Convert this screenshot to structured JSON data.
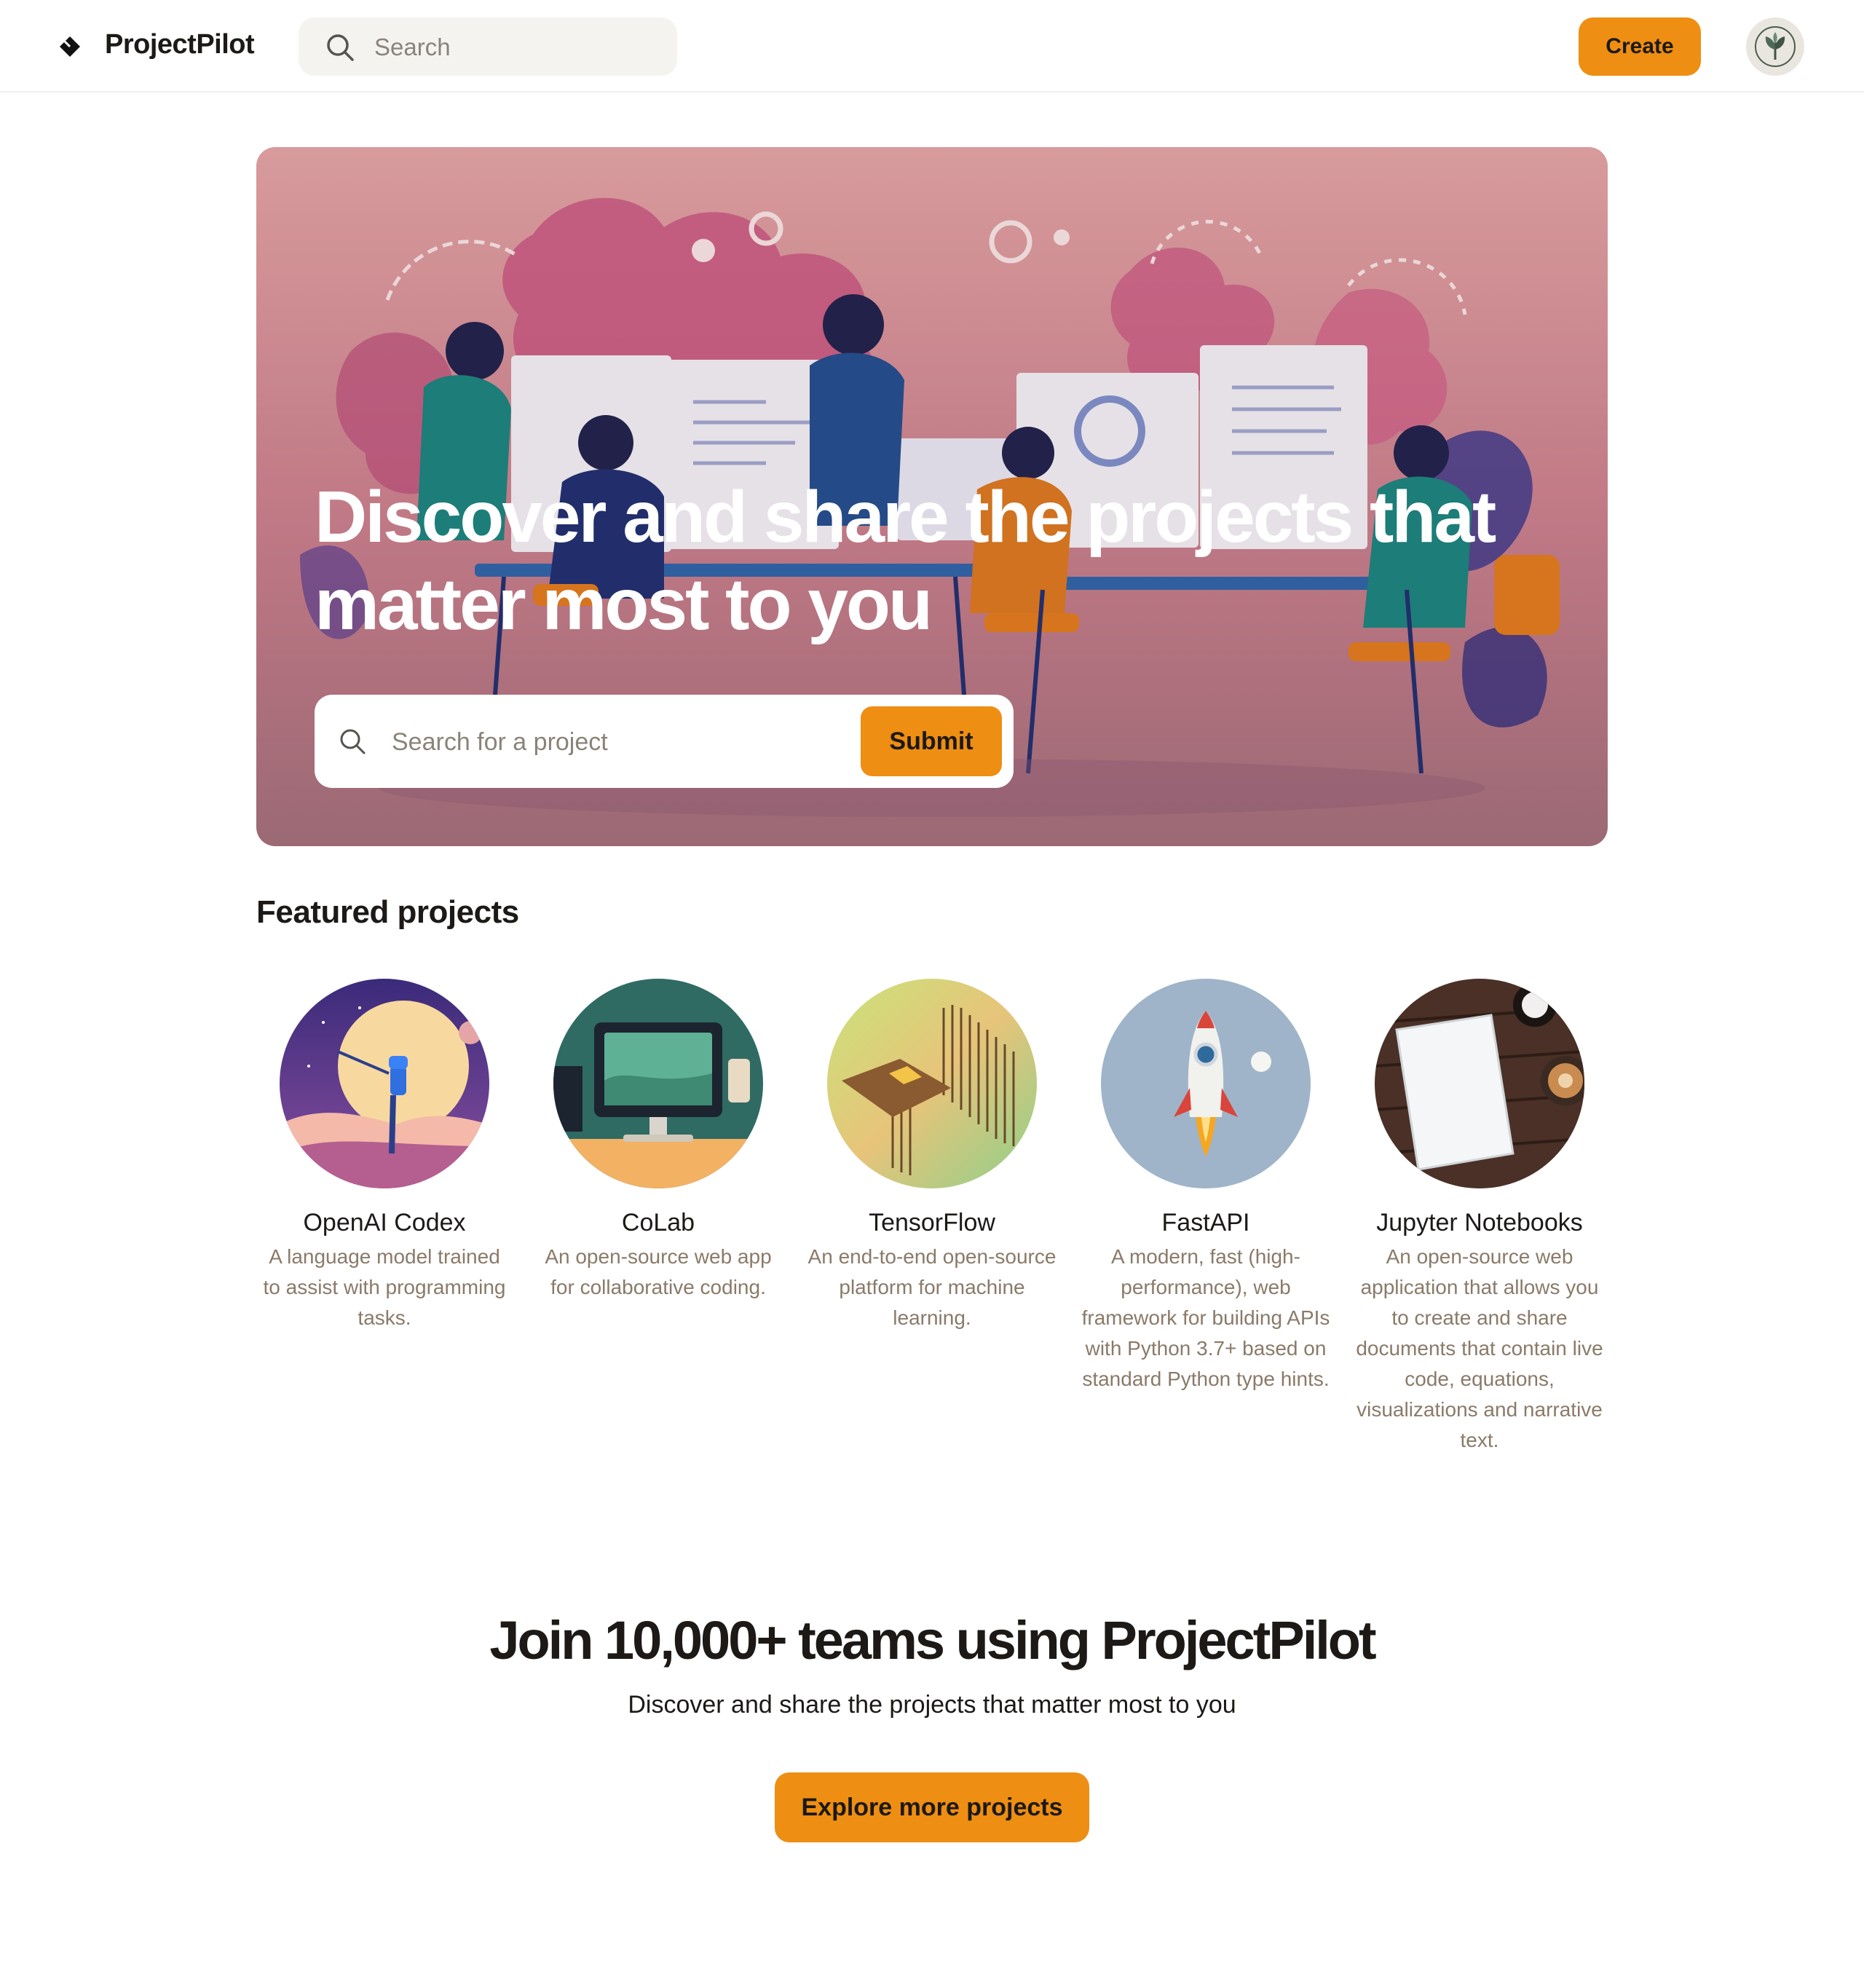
{
  "header": {
    "app_name": "ProjectPilot",
    "search_placeholder": "Search",
    "create_label": "Create"
  },
  "hero": {
    "title": "Discover and share the projects that matter most to you",
    "search_placeholder": "Search for a project",
    "submit_label": "Submit"
  },
  "featured": {
    "title": "Featured projects",
    "projects": [
      {
        "name": "OpenAI Codex",
        "description": "A language model trained to assist with programming tasks.",
        "image": "robot-moon-illustration"
      },
      {
        "name": "CoLab",
        "description": "An open-source web app for collaborative coding.",
        "image": "computer-desk-illustration"
      },
      {
        "name": "TensorFlow",
        "description": "An end-to-end open-source platform for machine learning.",
        "image": "circuit-chip-illustration"
      },
      {
        "name": "FastAPI",
        "description": "A modern, fast (high-performance), web framework for building APIs with Python 3.7+ based on standard Python type hints.",
        "image": "rocket-illustration"
      },
      {
        "name": "Jupyter Notebooks",
        "description": "An open-source web application that allows you to create and share documents that contain live code, equations, visualizations and narrative text.",
        "image": "notebook-coffee-photo"
      }
    ]
  },
  "cta": {
    "title": "Join 10,000+ teams using ProjectPilot",
    "subtitle": "Discover and share the projects that matter most to you",
    "button_label": "Explore more projects"
  },
  "colors": {
    "accent": "#ee8e12",
    "text": "#1c1917",
    "muted": "#8a7a69",
    "search_bg": "#f4f3f0"
  }
}
